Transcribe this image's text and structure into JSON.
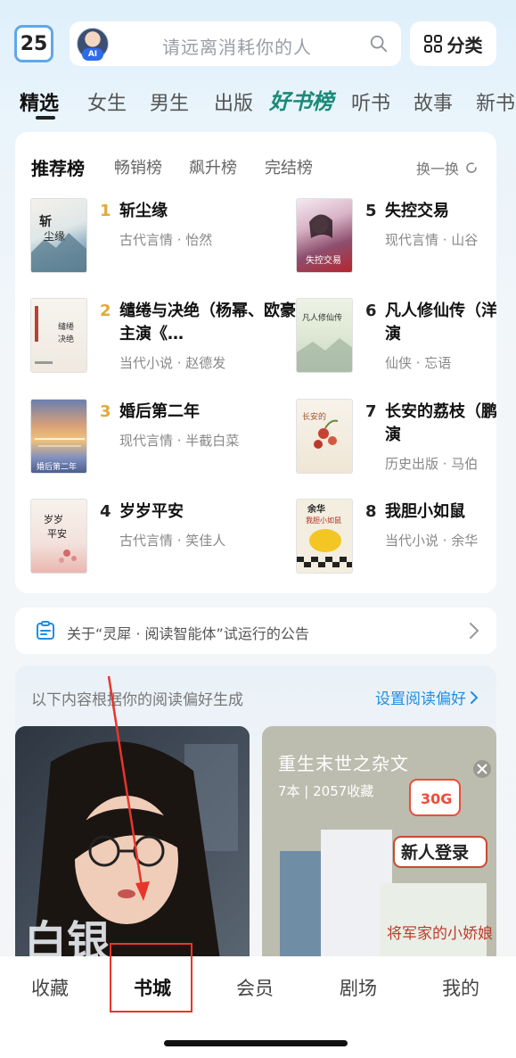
{
  "header": {
    "day_badge": "25",
    "ai_tag": "AI",
    "search_placeholder": "请远离消耗你的人",
    "category_label": "分类"
  },
  "tabs": [
    "精选",
    "女生",
    "男生",
    "出版",
    "好书榜",
    "听书",
    "故事",
    "新书"
  ],
  "active_tab": "精选",
  "ranking": {
    "tabs": [
      "推荐榜",
      "畅销榜",
      "飙升榜",
      "完结榜"
    ],
    "active_tab": "推荐榜",
    "refresh_label": "换一换",
    "books": [
      {
        "rank": "1",
        "title": "斩尘缘",
        "meta": "古代言情 · 怡然"
      },
      {
        "rank": "2",
        "title": "缱绻与决绝（杨幂、欧豪主演《…",
        "meta": "当代小说 · 赵德发"
      },
      {
        "rank": "3",
        "title": "婚后第二年",
        "meta": "现代言情 · 半截白菜"
      },
      {
        "rank": "4",
        "title": "岁岁平安",
        "meta": "古代言情 · 笑佳人"
      },
      {
        "rank": "5",
        "title": "失控交易",
        "meta": "现代言情 · 山谷"
      },
      {
        "rank": "6",
        "title": "凡人修仙传（洋、金晨主演",
        "meta": "仙侠 · 忘语"
      },
      {
        "rank": "7",
        "title": "长安的荔枝（鹏、白客主演",
        "meta": "历史出版 · 马伯"
      },
      {
        "rank": "8",
        "title": "我胆小如鼠",
        "meta": "当代小说 · 余华"
      }
    ]
  },
  "notice": {
    "text": "关于“灵犀 · 阅读智能体”试运行的公告"
  },
  "preference": {
    "hint": "以下内容根据你的阅读偏好生成",
    "link": "设置阅读偏好",
    "right_card": {
      "title": "重生末世之杂文",
      "meta": "7本 | 2057收藏",
      "promo": "新人登录",
      "promo_amount": "30G",
      "book_cover_text": "将军家的小娇娘"
    }
  },
  "bottom_nav": [
    "收藏",
    "书城",
    "会员",
    "剧场",
    "我的"
  ],
  "active_nav": "书城",
  "colors": {
    "accent_blue": "#1f8ee3",
    "rank_gold": "#e0a93a",
    "annotation_red": "#e8352b"
  }
}
